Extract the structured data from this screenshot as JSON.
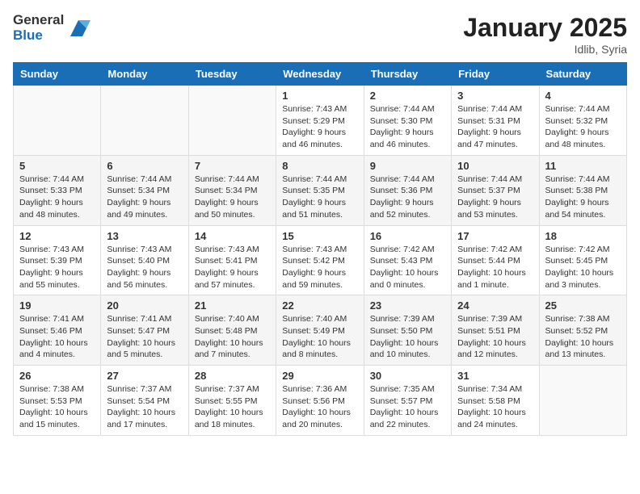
{
  "header": {
    "logo_general": "General",
    "logo_blue": "Blue",
    "month": "January 2025",
    "location": "Idlib, Syria"
  },
  "weekdays": [
    "Sunday",
    "Monday",
    "Tuesday",
    "Wednesday",
    "Thursday",
    "Friday",
    "Saturday"
  ],
  "weeks": [
    [
      {
        "day": "",
        "info": ""
      },
      {
        "day": "",
        "info": ""
      },
      {
        "day": "",
        "info": ""
      },
      {
        "day": "1",
        "info": "Sunrise: 7:43 AM\nSunset: 5:29 PM\nDaylight: 9 hours\nand 46 minutes."
      },
      {
        "day": "2",
        "info": "Sunrise: 7:44 AM\nSunset: 5:30 PM\nDaylight: 9 hours\nand 46 minutes."
      },
      {
        "day": "3",
        "info": "Sunrise: 7:44 AM\nSunset: 5:31 PM\nDaylight: 9 hours\nand 47 minutes."
      },
      {
        "day": "4",
        "info": "Sunrise: 7:44 AM\nSunset: 5:32 PM\nDaylight: 9 hours\nand 48 minutes."
      }
    ],
    [
      {
        "day": "5",
        "info": "Sunrise: 7:44 AM\nSunset: 5:33 PM\nDaylight: 9 hours\nand 48 minutes."
      },
      {
        "day": "6",
        "info": "Sunrise: 7:44 AM\nSunset: 5:34 PM\nDaylight: 9 hours\nand 49 minutes."
      },
      {
        "day": "7",
        "info": "Sunrise: 7:44 AM\nSunset: 5:34 PM\nDaylight: 9 hours\nand 50 minutes."
      },
      {
        "day": "8",
        "info": "Sunrise: 7:44 AM\nSunset: 5:35 PM\nDaylight: 9 hours\nand 51 minutes."
      },
      {
        "day": "9",
        "info": "Sunrise: 7:44 AM\nSunset: 5:36 PM\nDaylight: 9 hours\nand 52 minutes."
      },
      {
        "day": "10",
        "info": "Sunrise: 7:44 AM\nSunset: 5:37 PM\nDaylight: 9 hours\nand 53 minutes."
      },
      {
        "day": "11",
        "info": "Sunrise: 7:44 AM\nSunset: 5:38 PM\nDaylight: 9 hours\nand 54 minutes."
      }
    ],
    [
      {
        "day": "12",
        "info": "Sunrise: 7:43 AM\nSunset: 5:39 PM\nDaylight: 9 hours\nand 55 minutes."
      },
      {
        "day": "13",
        "info": "Sunrise: 7:43 AM\nSunset: 5:40 PM\nDaylight: 9 hours\nand 56 minutes."
      },
      {
        "day": "14",
        "info": "Sunrise: 7:43 AM\nSunset: 5:41 PM\nDaylight: 9 hours\nand 57 minutes."
      },
      {
        "day": "15",
        "info": "Sunrise: 7:43 AM\nSunset: 5:42 PM\nDaylight: 9 hours\nand 59 minutes."
      },
      {
        "day": "16",
        "info": "Sunrise: 7:42 AM\nSunset: 5:43 PM\nDaylight: 10 hours\nand 0 minutes."
      },
      {
        "day": "17",
        "info": "Sunrise: 7:42 AM\nSunset: 5:44 PM\nDaylight: 10 hours\nand 1 minute."
      },
      {
        "day": "18",
        "info": "Sunrise: 7:42 AM\nSunset: 5:45 PM\nDaylight: 10 hours\nand 3 minutes."
      }
    ],
    [
      {
        "day": "19",
        "info": "Sunrise: 7:41 AM\nSunset: 5:46 PM\nDaylight: 10 hours\nand 4 minutes."
      },
      {
        "day": "20",
        "info": "Sunrise: 7:41 AM\nSunset: 5:47 PM\nDaylight: 10 hours\nand 5 minutes."
      },
      {
        "day": "21",
        "info": "Sunrise: 7:40 AM\nSunset: 5:48 PM\nDaylight: 10 hours\nand 7 minutes."
      },
      {
        "day": "22",
        "info": "Sunrise: 7:40 AM\nSunset: 5:49 PM\nDaylight: 10 hours\nand 8 minutes."
      },
      {
        "day": "23",
        "info": "Sunrise: 7:39 AM\nSunset: 5:50 PM\nDaylight: 10 hours\nand 10 minutes."
      },
      {
        "day": "24",
        "info": "Sunrise: 7:39 AM\nSunset: 5:51 PM\nDaylight: 10 hours\nand 12 minutes."
      },
      {
        "day": "25",
        "info": "Sunrise: 7:38 AM\nSunset: 5:52 PM\nDaylight: 10 hours\nand 13 minutes."
      }
    ],
    [
      {
        "day": "26",
        "info": "Sunrise: 7:38 AM\nSunset: 5:53 PM\nDaylight: 10 hours\nand 15 minutes."
      },
      {
        "day": "27",
        "info": "Sunrise: 7:37 AM\nSunset: 5:54 PM\nDaylight: 10 hours\nand 17 minutes."
      },
      {
        "day": "28",
        "info": "Sunrise: 7:37 AM\nSunset: 5:55 PM\nDaylight: 10 hours\nand 18 minutes."
      },
      {
        "day": "29",
        "info": "Sunrise: 7:36 AM\nSunset: 5:56 PM\nDaylight: 10 hours\nand 20 minutes."
      },
      {
        "day": "30",
        "info": "Sunrise: 7:35 AM\nSunset: 5:57 PM\nDaylight: 10 hours\nand 22 minutes."
      },
      {
        "day": "31",
        "info": "Sunrise: 7:34 AM\nSunset: 5:58 PM\nDaylight: 10 hours\nand 24 minutes."
      },
      {
        "day": "",
        "info": ""
      }
    ]
  ]
}
